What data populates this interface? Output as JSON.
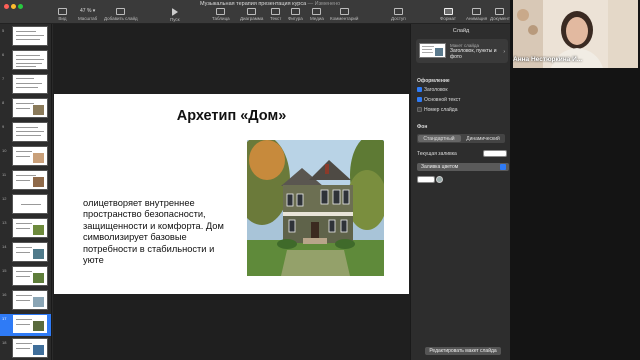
{
  "window": {
    "title": "Музыкальная терапия презентация курса",
    "title_suffix": "— Изменено"
  },
  "toolbar": {
    "zoom_value": "47 %",
    "items": [
      {
        "label": "Вид",
        "icon": "view-icon"
      },
      {
        "label": "Масштаб",
        "icon": "zoom-icon"
      },
      {
        "label": "Добавить слайд",
        "icon": "add-slide-icon"
      },
      {
        "label": "Пуск",
        "icon": "play-icon"
      },
      {
        "label": "Таблица",
        "icon": "table-icon"
      },
      {
        "label": "Диаграмма",
        "icon": "chart-icon"
      },
      {
        "label": "Текст",
        "icon": "text-icon"
      },
      {
        "label": "Фигура",
        "icon": "shape-icon"
      },
      {
        "label": "Медиа",
        "icon": "media-icon"
      },
      {
        "label": "Комментарий",
        "icon": "comment-icon"
      },
      {
        "label": "Доступ",
        "icon": "share-icon"
      },
      {
        "label": "Формат",
        "icon": "format-icon"
      },
      {
        "label": "Анимация",
        "icon": "animate-icon"
      },
      {
        "label": "Документ",
        "icon": "document-icon"
      }
    ]
  },
  "navigator": {
    "slides": [
      "5",
      "6",
      "7",
      "8",
      "9",
      "10",
      "11",
      "12",
      "13",
      "14",
      "15",
      "16",
      "17",
      "18"
    ],
    "selected": "17"
  },
  "slide": {
    "title": "Архетип «Дом»",
    "body": "олицетворяет внутреннее пространство безопасности, защищенности и комфорта. Дом символизирует базовые потребности в стабильности и уюте"
  },
  "inspector": {
    "tab": "Слайд",
    "layout_caption": "Макет слайда",
    "layout_name": "Заголовок, пункты и фото",
    "appearance_header": "Оформление",
    "checkboxes": [
      {
        "label": "Заголовок",
        "checked": true
      },
      {
        "label": "Основной текст",
        "checked": true
      },
      {
        "label": "Номер слайда",
        "checked": false
      }
    ],
    "background_header": "Фон",
    "segments": [
      "Стандартный",
      "Динамический"
    ],
    "current_fill_label": "Текущая заливка",
    "fill_type": "Заливка цветом",
    "edit_layout_button": "Редактировать макет слайда"
  },
  "video": {
    "participant_name": "Анна Нестюркина И..."
  },
  "colors": {
    "accent": "#2f7bf6",
    "slide_bg": "#ffffff"
  }
}
